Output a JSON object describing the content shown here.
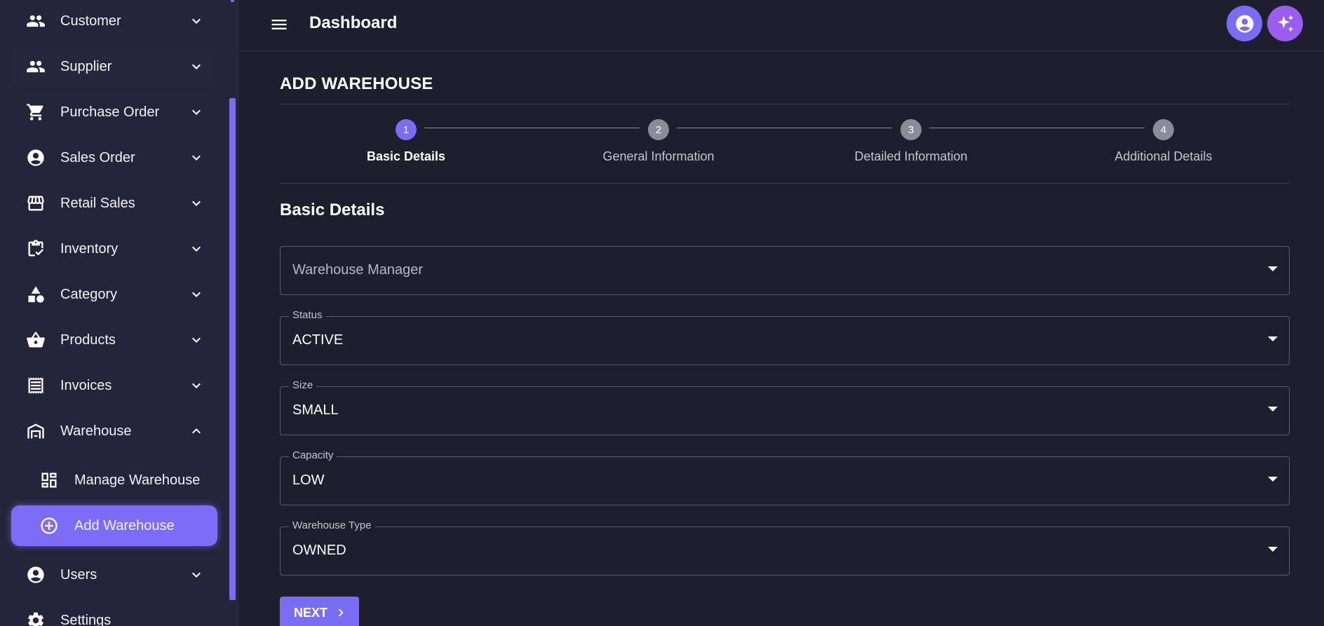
{
  "topbar": {
    "title": "Dashboard"
  },
  "sidebar": {
    "items": [
      {
        "label": "Customer",
        "icon": "people-icon"
      },
      {
        "label": "Supplier",
        "icon": "people-icon"
      },
      {
        "label": "Purchase Order",
        "icon": "cart-icon"
      },
      {
        "label": "Sales Order",
        "icon": "account-circle-icon"
      },
      {
        "label": "Retail Sales",
        "icon": "store-icon"
      },
      {
        "label": "Inventory",
        "icon": "clipboard-check-icon"
      },
      {
        "label": "Category",
        "icon": "shapes-icon"
      },
      {
        "label": "Products",
        "icon": "basket-icon"
      },
      {
        "label": "Invoices",
        "icon": "receipt-icon"
      },
      {
        "label": "Warehouse",
        "icon": "warehouse-icon"
      },
      {
        "label": "Users",
        "icon": "account-circle-icon"
      },
      {
        "label": "Settings",
        "icon": "gear-icon"
      }
    ],
    "warehouse_sub": [
      {
        "label": "Manage Warehouse",
        "icon": "dashboard-grid-icon"
      },
      {
        "label": "Add Warehouse",
        "icon": "add-circle-icon"
      }
    ]
  },
  "main": {
    "page_title": "ADD WAREHOUSE",
    "steps": [
      {
        "number": "1",
        "label": "Basic Details"
      },
      {
        "number": "2",
        "label": "General Information"
      },
      {
        "number": "3",
        "label": "Detailed Information"
      },
      {
        "number": "4",
        "label": "Additional Details"
      }
    ],
    "active_step": 1,
    "section_title": "Basic Details",
    "fields": {
      "manager": {
        "placeholder": "Warehouse Manager"
      },
      "status": {
        "label": "Status",
        "value": "ACTIVE"
      },
      "size": {
        "label": "Size",
        "value": "SMALL"
      },
      "capacity": {
        "label": "Capacity",
        "value": "LOW"
      },
      "type": {
        "label": "Warehouse Type",
        "value": "OWNED"
      }
    },
    "next_label": "NEXT"
  },
  "colors": {
    "accent": "#7b6cf6",
    "background": "#1f1e2e",
    "sidebar": "#24243a",
    "ai_button": "#9b5cf0"
  }
}
